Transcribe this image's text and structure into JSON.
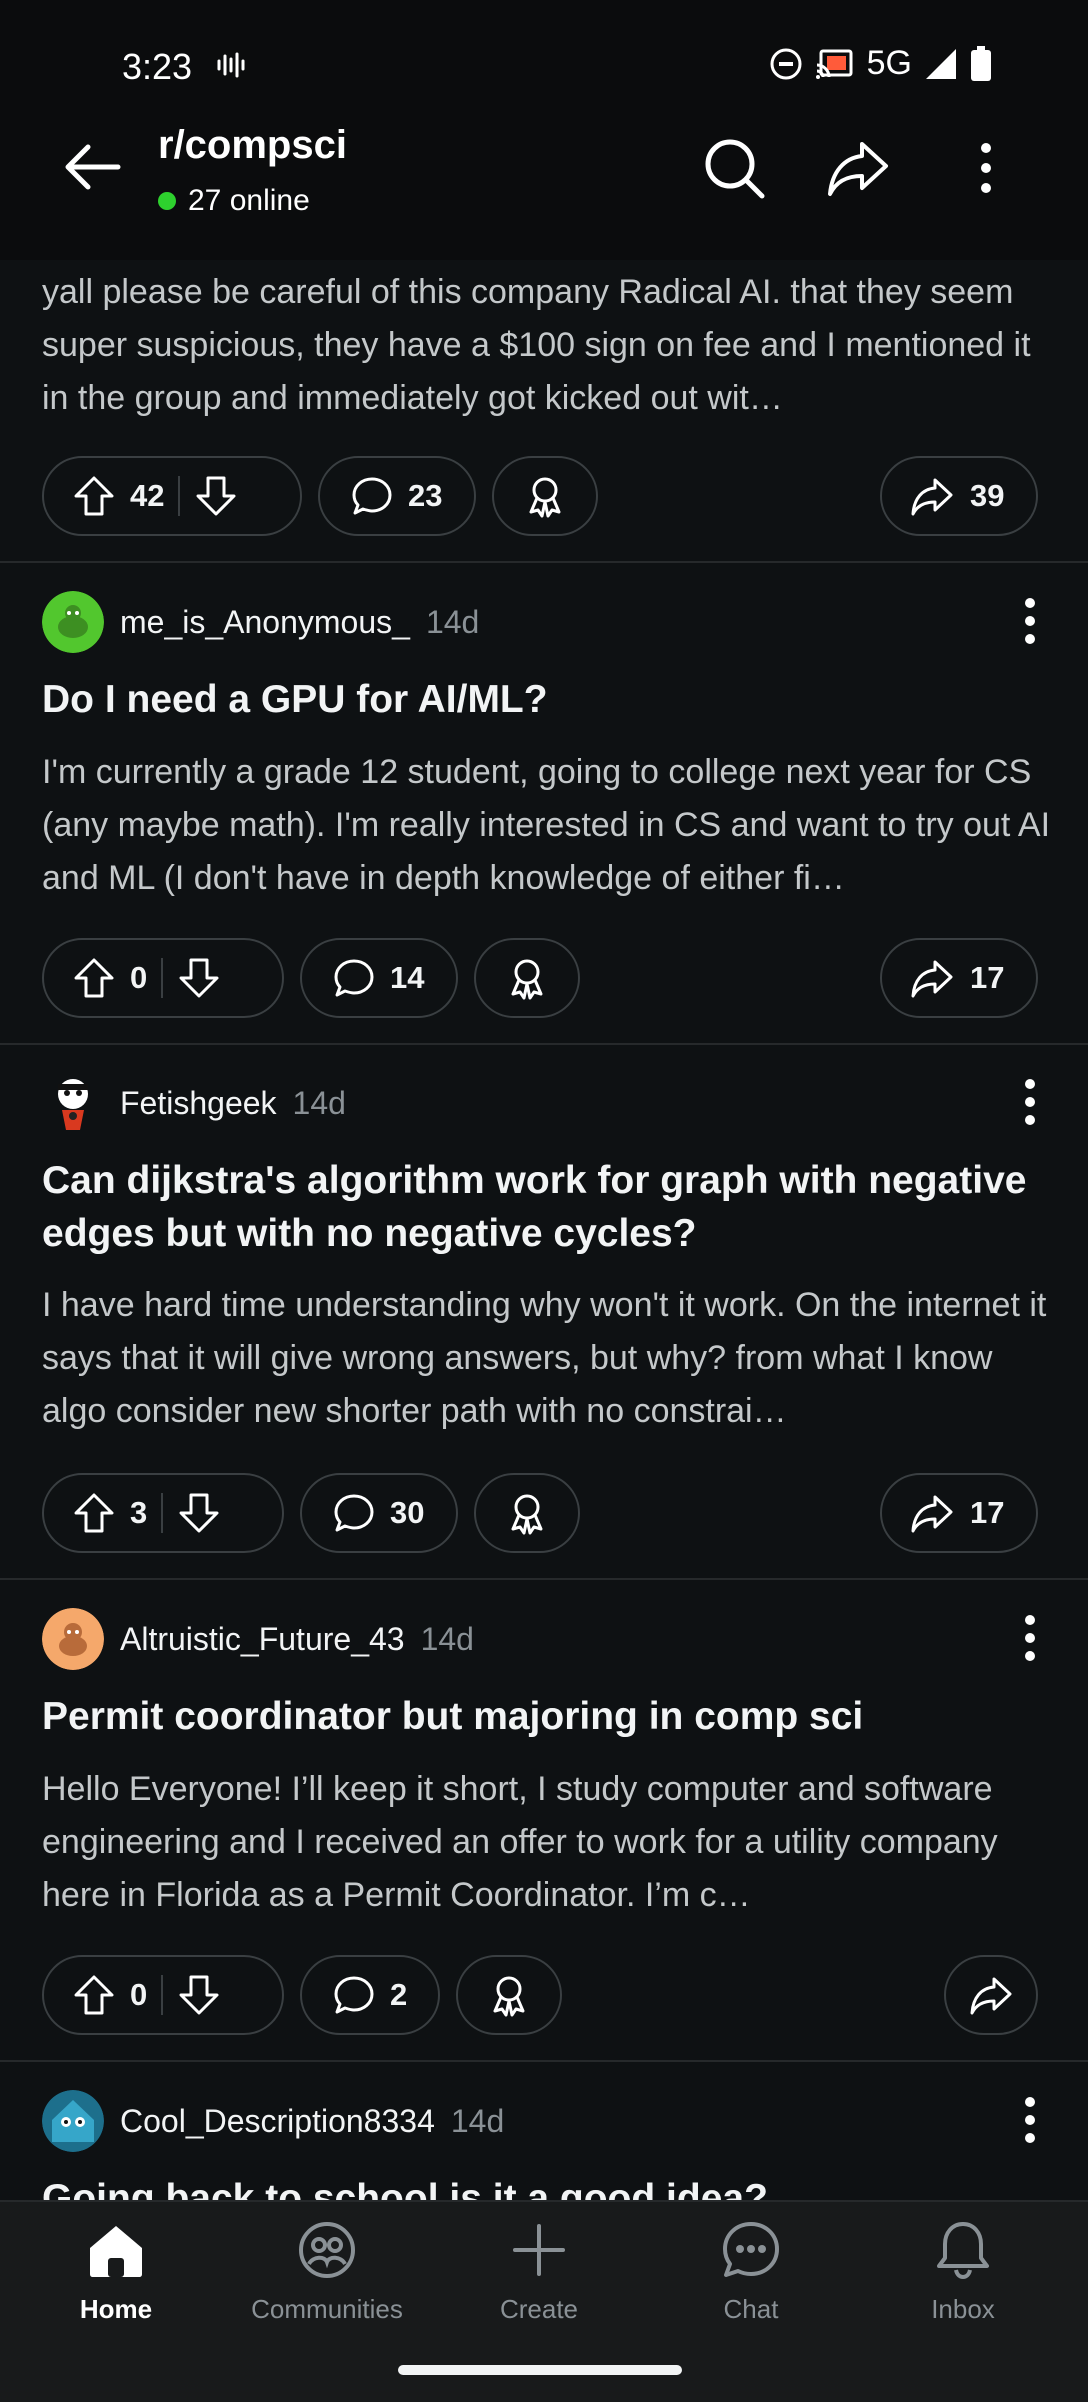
{
  "status": {
    "time": "3:23",
    "network": "5G"
  },
  "header": {
    "title": "r/compsci",
    "online": "27 online"
  },
  "posts": [
    {
      "body": "yall please be careful of this company Radical AI. that they seem super suspicious, they have a $100 sign on fee and I mentioned it in the group and immediately got kicked out wit…",
      "upvotes": "42",
      "comments": "23",
      "shares": "39"
    },
    {
      "author": "me_is_Anonymous_",
      "age": "14d",
      "title": "Do I need a GPU for AI/ML?",
      "body": "I'm currently a grade 12 student, going to college next year for CS (any maybe math). I'm really interested in CS and want to try out AI and ML (I don't have in depth knowledge of either fi…",
      "upvotes": "0",
      "comments": "14",
      "shares": "17"
    },
    {
      "author": "Fetishgeek",
      "age": "14d",
      "title": "Can dijkstra's algorithm work for graph with negative edges but with no negative cycles?",
      "body": "I have hard time understanding why won't it work. On the internet it says that it will give wrong answers, but why? from what I know algo consider new shorter path with no constrai…",
      "upvotes": "3",
      "comments": "30",
      "shares": "17"
    },
    {
      "author": "Altruistic_Future_43",
      "age": "14d",
      "title": "Permit coordinator but majoring in comp sci",
      "body": "Hello Everyone! I’ll keep it short, I study computer and software engineering and I received an offer to work for a utility company here in Florida as a Permit Coordinator. I’m c…",
      "upvotes": "0",
      "comments": "2"
    },
    {
      "author": "Cool_Description8334",
      "age": "14d",
      "title": "Going back to school is it a good idea?"
    }
  ],
  "nav": {
    "home": "Home",
    "communities": "Communities",
    "create": "Create",
    "chat": "Chat",
    "inbox": "Inbox"
  },
  "colors": {
    "background": "#0e1113",
    "online_dot": "#2ed12e",
    "nav_bg": "#181a1b"
  }
}
